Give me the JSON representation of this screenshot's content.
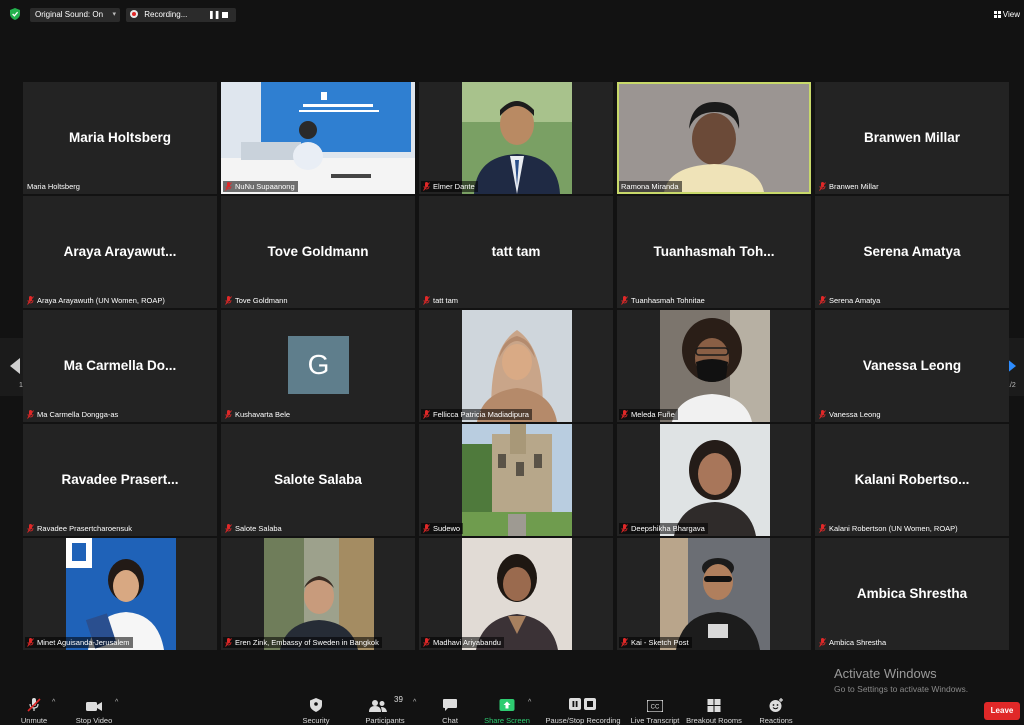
{
  "top_bar": {
    "original_sound": "Original Sound: On",
    "recording": "Recording...",
    "view": "View"
  },
  "gallery": {
    "page_label": "1/2",
    "tiles": [
      {
        "display_name": "Maria Holtsberg",
        "label": "Maria Holtsberg",
        "muted": false,
        "has_video": false
      },
      {
        "display_name": "",
        "label": "NuNu Supaanong",
        "muted": true,
        "has_video": true
      },
      {
        "display_name": "",
        "label": "Elmer Dante",
        "muted": true,
        "has_video": true
      },
      {
        "display_name": "",
        "label": "Ramona Miranda",
        "muted": false,
        "has_video": true,
        "active_speaker": true
      },
      {
        "display_name": "Branwen Millar",
        "label": "Branwen Millar",
        "muted": true,
        "has_video": false
      },
      {
        "display_name": "Araya Arayawut...",
        "label": "Araya Arayawuth (UN Women, ROAP)",
        "muted": true,
        "has_video": false
      },
      {
        "display_name": "Tove Goldmann",
        "label": "Tove Goldmann",
        "muted": true,
        "has_video": false
      },
      {
        "display_name": "tatt tam",
        "label": "tatt tam",
        "muted": true,
        "has_video": false
      },
      {
        "display_name": "Tuanhasmah Toh...",
        "label": "Tuanhasmah Tohnitae",
        "muted": true,
        "has_video": false
      },
      {
        "display_name": "Serena Amatya",
        "label": "Serena Amatya",
        "muted": true,
        "has_video": false
      },
      {
        "display_name": "Ma Carmella Do...",
        "label": "Ma Carmella Dongga-as",
        "muted": true,
        "has_video": false
      },
      {
        "display_name": "",
        "label": "Kushavarta Bele",
        "muted": true,
        "has_video": false,
        "avatar_letter": "G"
      },
      {
        "display_name": "",
        "label": "Fellicca Patricia Madiadipura",
        "muted": true,
        "has_video": true
      },
      {
        "display_name": "",
        "label": "Meleda Fuñe",
        "muted": true,
        "has_video": true
      },
      {
        "display_name": "Vanessa Leong",
        "label": "Vanessa Leong",
        "muted": true,
        "has_video": false
      },
      {
        "display_name": "Ravadee Prasert...",
        "label": "Ravadee Prasertcharoensuk",
        "muted": true,
        "has_video": false
      },
      {
        "display_name": "Salote Salaba",
        "label": "Salote Salaba",
        "muted": true,
        "has_video": false
      },
      {
        "display_name": "",
        "label": "Sudewo",
        "muted": true,
        "has_video": true
      },
      {
        "display_name": "",
        "label": "Deepshikha Bhargava",
        "muted": true,
        "has_video": true
      },
      {
        "display_name": "Kalani Robertso...",
        "label": "Kalani Robertson (UN Women, ROAP)",
        "muted": true,
        "has_video": false
      },
      {
        "display_name": "",
        "label": "Minet Aguisanda-Jerusalem",
        "muted": true,
        "has_video": true
      },
      {
        "display_name": "",
        "label": "Eren Zink, Embassy of Sweden in Bangkok",
        "muted": true,
        "has_video": true
      },
      {
        "display_name": "",
        "label": "Madhavi Ariyabandu",
        "muted": true,
        "has_video": true
      },
      {
        "display_name": "",
        "label": "Kai - Sketch Post",
        "muted": true,
        "has_video": true
      },
      {
        "display_name": "Ambica Shrestha",
        "label": "Ambica Shrestha",
        "muted": true,
        "has_video": false
      }
    ]
  },
  "watermark": {
    "title": "Activate Windows",
    "subtitle": "Go to Settings to activate Windows."
  },
  "toolbar": {
    "unmute": "Unmute",
    "stop_video": "Stop Video",
    "security": "Security",
    "participants": "Participants",
    "participant_count": "39",
    "chat": "Chat",
    "share_screen": "Share Screen",
    "pause_stop_recording": "Pause/Stop Recording",
    "live_transcript": "Live Transcript",
    "breakout_rooms": "Breakout Rooms",
    "reactions": "Reactions",
    "leave": "Leave",
    "cc_text": "CC"
  },
  "colors": {
    "background": "#121212",
    "tile": "#232323",
    "active_speaker_border": "#c8d96a",
    "muted_icon": "#e02828",
    "share_green": "#2ecc71",
    "leave_red": "#e02828",
    "avatar_bg": "#5f7e8c"
  }
}
